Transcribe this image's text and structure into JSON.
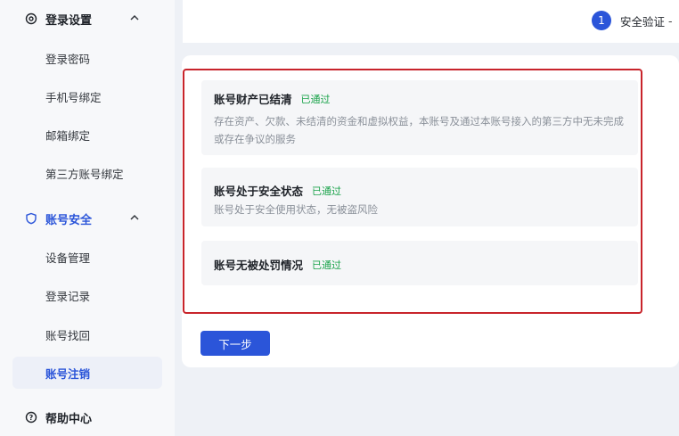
{
  "sidebar": {
    "login_settings": {
      "label": "登录设置",
      "items": [
        "登录密码",
        "手机号绑定",
        "邮箱绑定",
        "第三方账号绑定"
      ]
    },
    "account_security": {
      "label": "账号安全",
      "items": [
        "设备管理",
        "登录记录",
        "账号找回",
        "账号注销"
      ],
      "selected": "账号注销"
    },
    "help_center": {
      "label": "帮助中心"
    }
  },
  "stepper": {
    "number": "1",
    "label": "安全验证",
    "trail": "-"
  },
  "conditions": [
    {
      "title": "账号财产已结清",
      "status": "已通过",
      "description": "存在资产、欠款、未结清的资金和虚拟权益，本账号及通过本账号接入的第三方中无未完成或存在争议的服务"
    },
    {
      "title": "账号处于安全状态",
      "status": "已通过",
      "description": "账号处于安全使用状态，无被盗风险"
    },
    {
      "title": "账号无被处罚情况",
      "status": "已通过",
      "description": ""
    }
  ],
  "actions": {
    "next_label": "下一步"
  },
  "colors": {
    "accent": "#2b55d9",
    "pass": "#1aa34a",
    "highlight": "#c8242b"
  }
}
